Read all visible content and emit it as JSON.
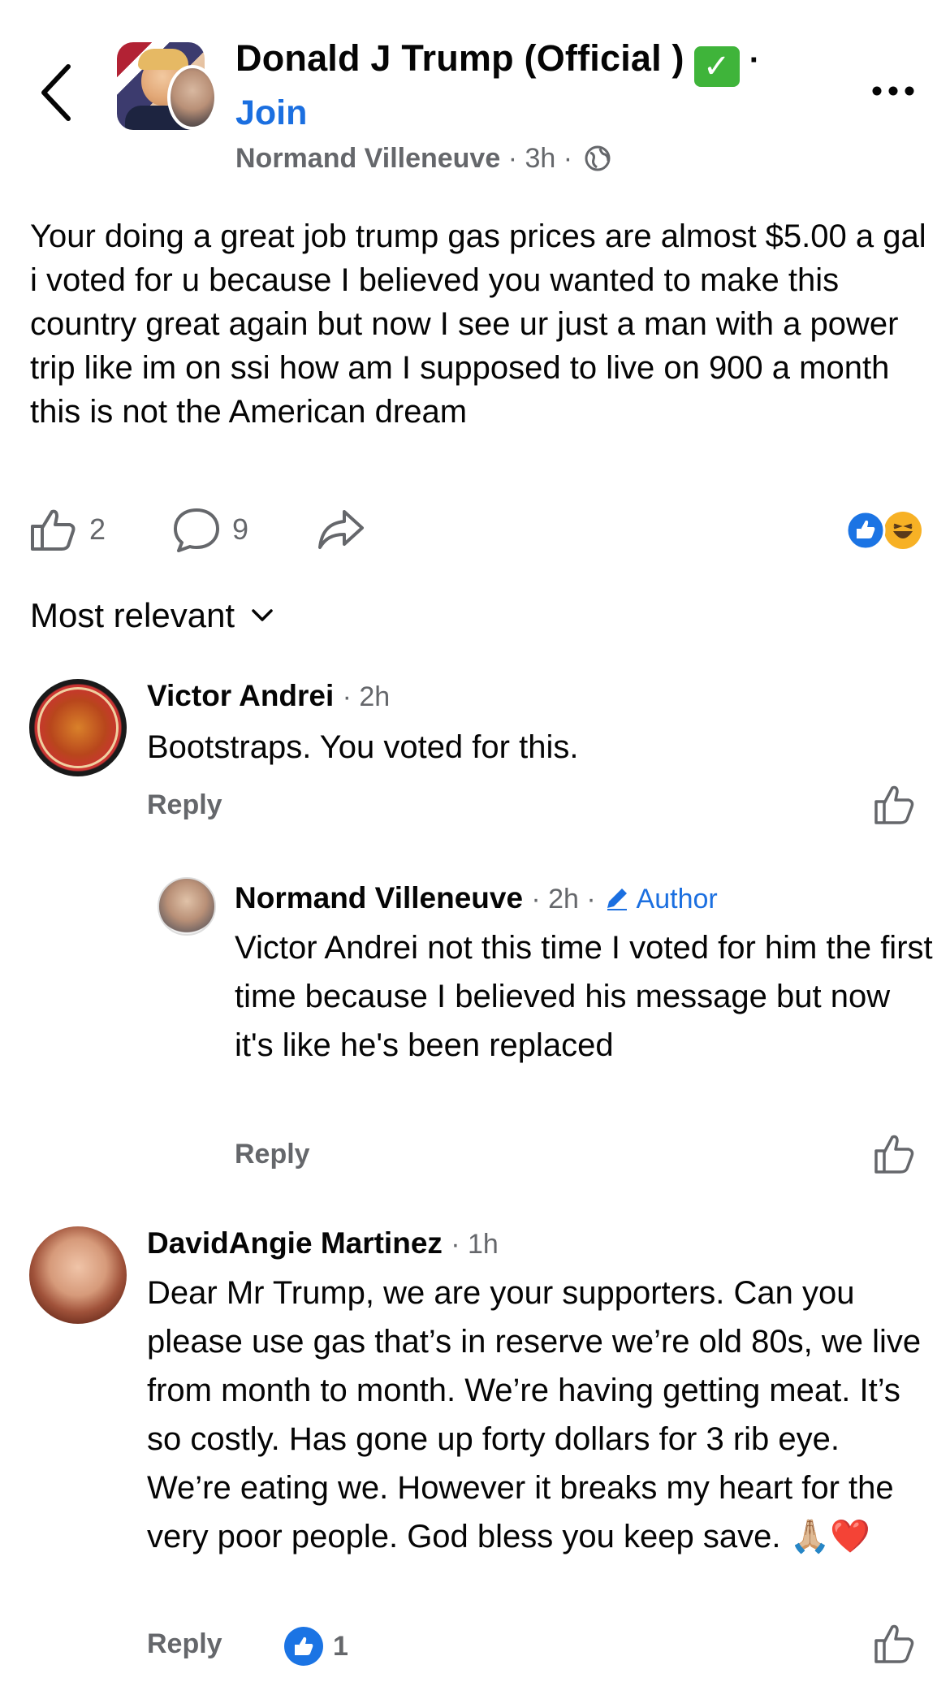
{
  "header": {
    "group_title": "Donald J Trump (Official )",
    "verified_glyph": "✓",
    "title_separator": "·",
    "join_label": "Join",
    "author": "Normand Villeneuve",
    "time": "3h",
    "separator": "·"
  },
  "post": {
    "text": "Your doing a great job trump gas prices are almost $5.00 a gal i voted for u because I believed you wanted to make this country great again but now I see ur just a man with a power trip like im on ssi how am I supposed to live on 900 a month this is not the American dream",
    "like_count": "2",
    "comment_count": "9",
    "reaction_icons": [
      "like-reaction-icon",
      "haha-reaction-icon"
    ],
    "reaction_colors": {
      "like": "#1b74e4",
      "haha": "#f7b125"
    }
  },
  "sort": {
    "label": "Most relevant"
  },
  "comments": [
    {
      "name": "Victor Andrei",
      "time": "· 2h",
      "text": "Bootstraps. You voted for this.",
      "reply_label": "Reply"
    },
    {
      "name": "Normand Villeneuve",
      "time": "· 2h ·",
      "author_label": "Author",
      "text": "Victor Andrei not this time I voted for him the first time because I believed his message but now it's like he's been replaced",
      "reply_label": "Reply"
    },
    {
      "name": "DavidAngie Martinez",
      "time": "· 1h",
      "text": "Dear Mr Trump,  we are your supporters. Can you please use gas that’s in reserve we’re old 80s, we live from month to month. We’re having getting meat. It’s so costly. Has gone up forty dollars for 3 rib eye. We’re eating we. However it breaks my heart for the very poor people. God bless you keep save. 🙏🏼❤️",
      "reply_label": "Reply",
      "reaction_count": "1"
    }
  ],
  "colors": {
    "accent": "#1b6fe0",
    "secondary_text": "#65676b",
    "verified_green": "#3fb43a"
  }
}
